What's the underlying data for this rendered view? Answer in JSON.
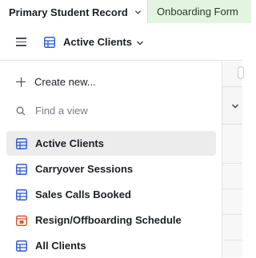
{
  "topbar": {
    "base_name": "Primary Student Record",
    "interface_tab": "Onboarding Form"
  },
  "viewbar": {
    "current_view": "Active Clients"
  },
  "sidebar": {
    "create_label": "Create new...",
    "find_placeholder": "Find a view",
    "views": [
      {
        "label": "Active Clients",
        "icon": "grid-view-icon",
        "active": true
      },
      {
        "label": "Carryover Sessions",
        "icon": "grid-view-icon",
        "active": false
      },
      {
        "label": "Sales Calls Booked",
        "icon": "grid-view-icon",
        "active": false
      },
      {
        "label": "Resign/Offboarding Schedule",
        "icon": "calendar-view-icon",
        "active": false
      },
      {
        "label": "All Clients",
        "icon": "grid-view-icon",
        "active": false
      }
    ]
  },
  "colors": {
    "grid_icon": "#2d5bd7",
    "calendar_icon": "#d9552c",
    "interface_tab_bg": "#e3f5e1",
    "active_row_bg": "#ececec"
  }
}
